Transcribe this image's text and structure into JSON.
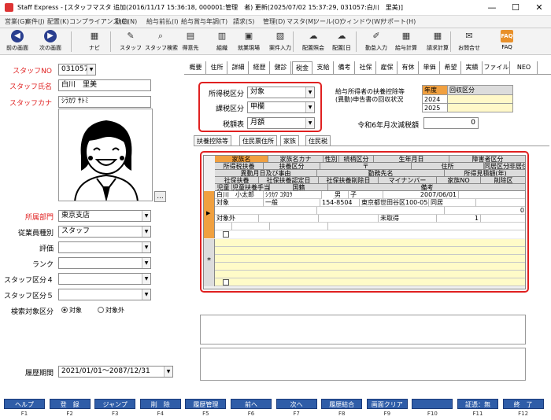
{
  "window": {
    "title": "Staff Express - [スタッフマスタ 追加(2016/11/17 15:36:18, 000001:管理　者) 更新(2025/07/02 15:37:29, 031057:白川　里美)]",
    "minimize": "—",
    "maximize": "☐",
    "close": "✕"
  },
  "menu": [
    "営業(G)",
    "案件(J)",
    "配置(K)",
    "コンプライアンス(C)",
    "勤怠(N)",
    "給与前払(I)",
    "給与賞与年調(T)",
    "請求(S)",
    "管理(D)",
    "マスタ(M)",
    "ツール(O)",
    "ウィンドウ(W)",
    "サポート(H)"
  ],
  "toolbar": [
    {
      "label": "前の画面",
      "glyph": "◀",
      "icon": "back-icon",
      "nav": true
    },
    {
      "label": "次の画面",
      "glyph": "▶",
      "icon": "forward-icon",
      "nav": true
    },
    {
      "label": "ナビ",
      "glyph": "▦",
      "icon": "navi-icon"
    },
    {
      "label": "スタッフ",
      "glyph": "✎",
      "icon": "staff-icon"
    },
    {
      "label": "スタッフ検索",
      "glyph": "⌕",
      "icon": "staff-search-icon"
    },
    {
      "label": "得意先",
      "glyph": "▤",
      "icon": "client-icon"
    },
    {
      "label": "組織",
      "glyph": "▥",
      "icon": "organization-icon"
    },
    {
      "label": "就業現場",
      "glyph": "▣",
      "icon": "worksite-icon"
    },
    {
      "label": "案件入力",
      "glyph": "▧",
      "icon": "order-input-icon"
    },
    {
      "label": "配置照会",
      "glyph": "☁",
      "icon": "assignment-inquiry-icon"
    },
    {
      "label": "配置[日",
      "glyph": "☁",
      "icon": "assignment-day-icon"
    },
    {
      "label": "勤怠入力",
      "glyph": "✐",
      "icon": "attendance-input-icon"
    },
    {
      "label": "給与計算",
      "glyph": "▦",
      "icon": "payroll-icon"
    },
    {
      "label": "請求計算",
      "glyph": "▦",
      "icon": "billing-icon"
    },
    {
      "label": "お問合せ",
      "glyph": "✉",
      "icon": "contact-icon"
    },
    {
      "label": "FAQ",
      "glyph": "FAQ",
      "icon": "faq-icon",
      "faq": true
    }
  ],
  "staff": {
    "no_label": "スタッフNO",
    "no": "031057",
    "name_label": "スタッフ氏名",
    "name": "白川　里美",
    "kana_label": "スタッフカナ",
    "kana": "ｼﾗｶﾜ ｻﾄﾐ",
    "photo_button": "..."
  },
  "fields": [
    {
      "label": "所属部門",
      "value": "東京支店",
      "red": true
    },
    {
      "label": "従業員種別",
      "value": "スタッフ"
    },
    {
      "label": "評価",
      "value": ""
    },
    {
      "label": "ランク",
      "value": ""
    },
    {
      "label": "スタッフ区分４",
      "value": ""
    },
    {
      "label": "スタッフ区分５",
      "value": ""
    }
  ],
  "search_target": {
    "label": "検索対象区分",
    "options": [
      "対象",
      "対象外"
    ],
    "selected": "対象"
  },
  "history": {
    "label": "履歴期間",
    "value": "2021/01/01～2087/12/31"
  },
  "tabs": [
    "概要",
    "住所",
    "詳細",
    "経歴",
    "健診",
    "税金",
    "支給",
    "備考",
    "社保",
    "雇保",
    "有休",
    "単価",
    "希望",
    "実績",
    "ファイル",
    "NEO"
  ],
  "active_tab": "税金",
  "tax": {
    "income_label": "所得税区分",
    "income": "対象",
    "class_label": "課税区分",
    "class": "甲欄",
    "table_label": "税額表",
    "table": "月額"
  },
  "dependents_notice": {
    "label": "給与所得者の扶養控除等\n(異動)申告書の回収状況",
    "col_year": "年度",
    "col_status": "回収区分",
    "years": [
      "2024",
      "2025"
    ]
  },
  "reduction": {
    "label": "令和6年月次減税額",
    "value": "0"
  },
  "subtabs": [
    "扶養控除等",
    "住民票住所",
    "家族",
    "住民税"
  ],
  "active_subtab": "家族",
  "grid_headers": [
    [
      {
        "t": "家族名",
        "o": true
      },
      {
        "t": "家族名カナ"
      },
      {
        "t": "性別"
      },
      {
        "t": "続柄区分"
      },
      {
        "t": "生年月日"
      },
      {
        "t": "障害者区分"
      }
    ],
    [
      {
        "t": "所得税扶養"
      },
      {
        "t": "扶養区分"
      },
      {
        "t": "〒"
      },
      {
        "t": "住所"
      },
      {
        "t": "同居区分"
      },
      {
        "t": "非居住"
      }
    ],
    [
      {
        "t": "異動月日及び事由"
      },
      {
        "t": "勤務先名"
      },
      {
        "t": "所得見積額(年)"
      }
    ],
    [
      {
        "t": "社保扶養"
      },
      {
        "t": "社保扶養認定日"
      },
      {
        "t": "社保扶養削除日"
      },
      {
        "t": "マイナンバー"
      },
      {
        "t": "家族NO"
      },
      {
        "t": "削除区"
      }
    ],
    [
      {
        "t": "児童"
      },
      {
        "t": "児童扶養手当"
      },
      {
        "t": "国籍"
      },
      {
        "t": "備考"
      }
    ]
  ],
  "family_row": {
    "name": "白川　小太郎",
    "kana": "ｼﾗｶﾜ ｺﾀﾛｳ",
    "sex": "男",
    "relation": "子",
    "birth": "2007/06/01",
    "tax_dep": "対象",
    "dep_class": "一般",
    "zip": "154-8504",
    "address": "東京都世田谷区100-058",
    "cohabit": "同居",
    "income": "0",
    "si_dep": "対象外",
    "mynumber": "未取得",
    "family_no": "1"
  },
  "fkeys": [
    {
      "label": "ヘルプ",
      "key": "F1"
    },
    {
      "label": "登　録",
      "key": "F2"
    },
    {
      "label": "ジャンプ",
      "key": "F3"
    },
    {
      "label": "削　除",
      "key": "F4"
    },
    {
      "label": "履歴管理",
      "key": "F5"
    },
    {
      "label": "前へ",
      "key": "F6"
    },
    {
      "label": "次へ",
      "key": "F7"
    },
    {
      "label": "履歴結合",
      "key": "F8"
    },
    {
      "label": "画面クリア",
      "key": "F9"
    },
    {
      "label": "",
      "key": "F10"
    },
    {
      "label": "証憑：無",
      "key": "F11"
    },
    {
      "label": "終　了",
      "key": "F12"
    }
  ]
}
